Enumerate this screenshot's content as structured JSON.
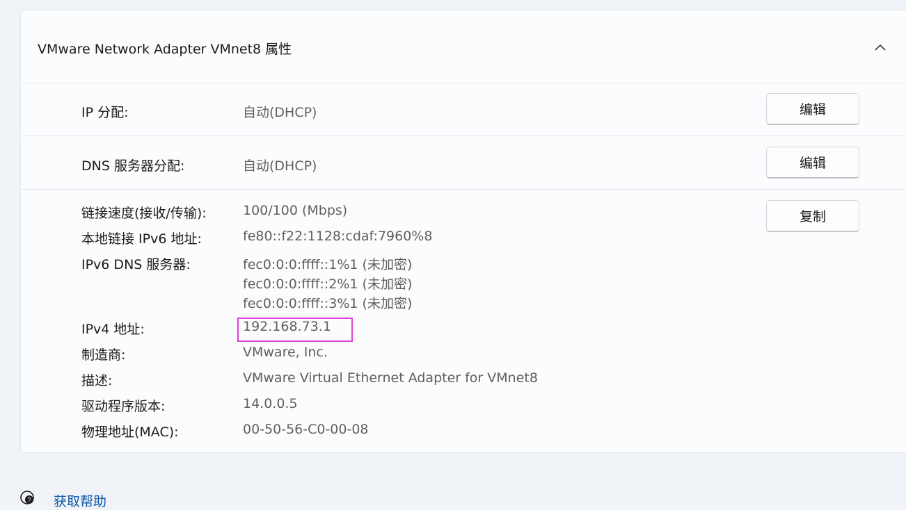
{
  "adapter": {
    "title": "VMware Network Adapter VMnet8 属性",
    "collapse_icon": "chevron-up-icon"
  },
  "ip_assignment": {
    "label": "IP 分配:",
    "value": "自动(DHCP)",
    "button": "编辑"
  },
  "dns_assignment": {
    "label": "DNS 服务器分配:",
    "value": "自动(DHCP)",
    "button": "编辑"
  },
  "details": {
    "copy_button": "复制",
    "link_speed": {
      "label": "链接速度(接收/传输):",
      "value": "100/100 (Mbps)"
    },
    "ipv6_link_local": {
      "label": "本地链接 IPv6 地址:",
      "value": "fe80::f22:1128:cdaf:7960%8"
    },
    "ipv6_dns": {
      "label": "IPv6 DNS 服务器:",
      "values": [
        "fec0:0:0:ffff::1%1 (未加密)",
        "fec0:0:0:ffff::2%1 (未加密)",
        "fec0:0:0:ffff::3%1 (未加密)"
      ]
    },
    "ipv4": {
      "label": "IPv4 地址:",
      "value": "192.168.73.1"
    },
    "manufacturer": {
      "label": "制造商:",
      "value": "VMware, Inc."
    },
    "description": {
      "label": "描述:",
      "value": "VMware Virtual Ethernet Adapter for VMnet8"
    },
    "driver_version": {
      "label": "驱动程序版本:",
      "value": "14.0.0.5"
    },
    "mac": {
      "label": "物理地址(MAC):",
      "value": "00-50-56-C0-00-08"
    }
  },
  "help": {
    "label": "获取帮助",
    "icon": "help-chat-icon"
  },
  "colors": {
    "highlight_box": "#e040d8",
    "link": "#0b57a4"
  }
}
